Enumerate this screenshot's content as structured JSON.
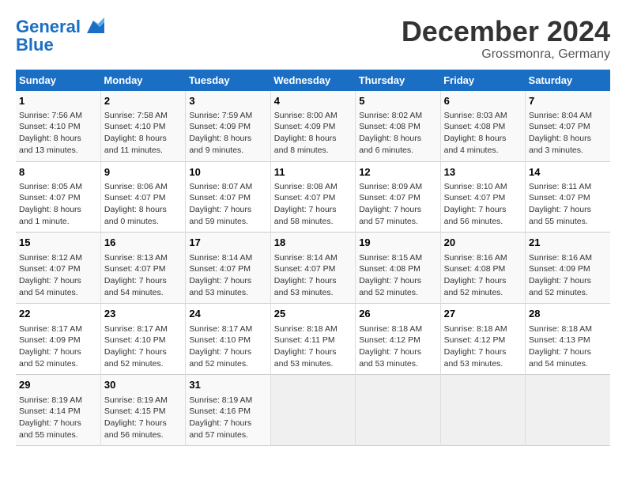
{
  "header": {
    "logo_line1": "General",
    "logo_line2": "Blue",
    "month_title": "December 2024",
    "location": "Grossmonra, Germany"
  },
  "weekdays": [
    "Sunday",
    "Monday",
    "Tuesday",
    "Wednesday",
    "Thursday",
    "Friday",
    "Saturday"
  ],
  "weeks": [
    [
      {
        "day": "1",
        "info": "Sunrise: 7:56 AM\nSunset: 4:10 PM\nDaylight: 8 hours and 13 minutes."
      },
      {
        "day": "2",
        "info": "Sunrise: 7:58 AM\nSunset: 4:10 PM\nDaylight: 8 hours and 11 minutes."
      },
      {
        "day": "3",
        "info": "Sunrise: 7:59 AM\nSunset: 4:09 PM\nDaylight: 8 hours and 9 minutes."
      },
      {
        "day": "4",
        "info": "Sunrise: 8:00 AM\nSunset: 4:09 PM\nDaylight: 8 hours and 8 minutes."
      },
      {
        "day": "5",
        "info": "Sunrise: 8:02 AM\nSunset: 4:08 PM\nDaylight: 8 hours and 6 minutes."
      },
      {
        "day": "6",
        "info": "Sunrise: 8:03 AM\nSunset: 4:08 PM\nDaylight: 8 hours and 4 minutes."
      },
      {
        "day": "7",
        "info": "Sunrise: 8:04 AM\nSunset: 4:07 PM\nDaylight: 8 hours and 3 minutes."
      }
    ],
    [
      {
        "day": "8",
        "info": "Sunrise: 8:05 AM\nSunset: 4:07 PM\nDaylight: 8 hours and 1 minute."
      },
      {
        "day": "9",
        "info": "Sunrise: 8:06 AM\nSunset: 4:07 PM\nDaylight: 8 hours and 0 minutes."
      },
      {
        "day": "10",
        "info": "Sunrise: 8:07 AM\nSunset: 4:07 PM\nDaylight: 7 hours and 59 minutes."
      },
      {
        "day": "11",
        "info": "Sunrise: 8:08 AM\nSunset: 4:07 PM\nDaylight: 7 hours and 58 minutes."
      },
      {
        "day": "12",
        "info": "Sunrise: 8:09 AM\nSunset: 4:07 PM\nDaylight: 7 hours and 57 minutes."
      },
      {
        "day": "13",
        "info": "Sunrise: 8:10 AM\nSunset: 4:07 PM\nDaylight: 7 hours and 56 minutes."
      },
      {
        "day": "14",
        "info": "Sunrise: 8:11 AM\nSunset: 4:07 PM\nDaylight: 7 hours and 55 minutes."
      }
    ],
    [
      {
        "day": "15",
        "info": "Sunrise: 8:12 AM\nSunset: 4:07 PM\nDaylight: 7 hours and 54 minutes."
      },
      {
        "day": "16",
        "info": "Sunrise: 8:13 AM\nSunset: 4:07 PM\nDaylight: 7 hours and 54 minutes."
      },
      {
        "day": "17",
        "info": "Sunrise: 8:14 AM\nSunset: 4:07 PM\nDaylight: 7 hours and 53 minutes."
      },
      {
        "day": "18",
        "info": "Sunrise: 8:14 AM\nSunset: 4:07 PM\nDaylight: 7 hours and 53 minutes."
      },
      {
        "day": "19",
        "info": "Sunrise: 8:15 AM\nSunset: 4:08 PM\nDaylight: 7 hours and 52 minutes."
      },
      {
        "day": "20",
        "info": "Sunrise: 8:16 AM\nSunset: 4:08 PM\nDaylight: 7 hours and 52 minutes."
      },
      {
        "day": "21",
        "info": "Sunrise: 8:16 AM\nSunset: 4:09 PM\nDaylight: 7 hours and 52 minutes."
      }
    ],
    [
      {
        "day": "22",
        "info": "Sunrise: 8:17 AM\nSunset: 4:09 PM\nDaylight: 7 hours and 52 minutes."
      },
      {
        "day": "23",
        "info": "Sunrise: 8:17 AM\nSunset: 4:10 PM\nDaylight: 7 hours and 52 minutes."
      },
      {
        "day": "24",
        "info": "Sunrise: 8:17 AM\nSunset: 4:10 PM\nDaylight: 7 hours and 52 minutes."
      },
      {
        "day": "25",
        "info": "Sunrise: 8:18 AM\nSunset: 4:11 PM\nDaylight: 7 hours and 53 minutes."
      },
      {
        "day": "26",
        "info": "Sunrise: 8:18 AM\nSunset: 4:12 PM\nDaylight: 7 hours and 53 minutes."
      },
      {
        "day": "27",
        "info": "Sunrise: 8:18 AM\nSunset: 4:12 PM\nDaylight: 7 hours and 53 minutes."
      },
      {
        "day": "28",
        "info": "Sunrise: 8:18 AM\nSunset: 4:13 PM\nDaylight: 7 hours and 54 minutes."
      }
    ],
    [
      {
        "day": "29",
        "info": "Sunrise: 8:19 AM\nSunset: 4:14 PM\nDaylight: 7 hours and 55 minutes."
      },
      {
        "day": "30",
        "info": "Sunrise: 8:19 AM\nSunset: 4:15 PM\nDaylight: 7 hours and 56 minutes."
      },
      {
        "day": "31",
        "info": "Sunrise: 8:19 AM\nSunset: 4:16 PM\nDaylight: 7 hours and 57 minutes."
      },
      null,
      null,
      null,
      null
    ]
  ]
}
